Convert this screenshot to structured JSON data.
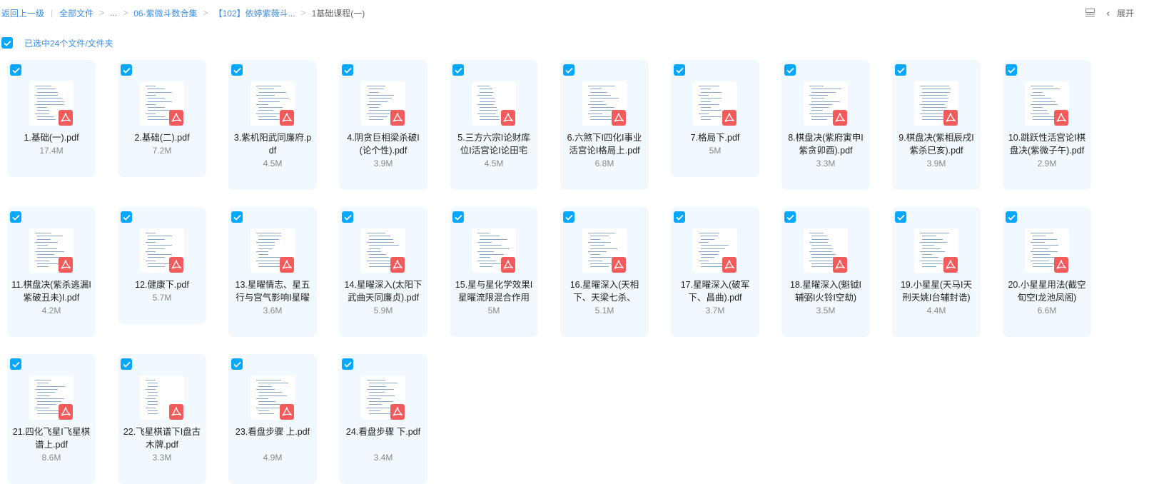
{
  "breadcrumb": {
    "back": "返回上一级",
    "items": [
      "全部文件",
      "...",
      "06-紫微斗数合集",
      "【102】依婷紫薇斗...",
      "1基础课程(一)"
    ]
  },
  "toolbar": {
    "expand": "展开"
  },
  "selection": {
    "text": "已选中24个文件/文件夹"
  },
  "colors": {
    "accent": "#06a7ff",
    "link": "#3b8ee6",
    "card_bg": "#f2f9fe",
    "pdf": "#f25b5b"
  },
  "files": [
    {
      "name": "1.基础(一).pdf",
      "size": "17.4M"
    },
    {
      "name": "2.基础(二).pdf",
      "size": "7.2M"
    },
    {
      "name": "3.紫机阳武同廉府.pdf",
      "size": "4.5M"
    },
    {
      "name": "4.阴贪巨相梁杀破I(论个性).pdf",
      "size": "3.9M"
    },
    {
      "name": "5.三方六宗I论财库位I活宫论I论田宅",
      "size": "4.5M"
    },
    {
      "name": "6.六煞下I四化I事业活宫论I格局上.pdf",
      "size": "6.8M"
    },
    {
      "name": "7.格局下.pdf",
      "size": "5M"
    },
    {
      "name": "8.棋盘决(紫府寅申I紫贪卯酉).pdf",
      "size": "3.3M"
    },
    {
      "name": "9.棋盘决(紫相辰戌I紫杀巳亥).pdf",
      "size": "3.9M"
    },
    {
      "name": "10.跳跃性活宫论I棋盘决(紫微子午).pdf",
      "size": "2.9M"
    },
    {
      "name": "11.棋盘决(紫杀逃漏I紫破丑未)I.pdf",
      "size": "4.2M"
    },
    {
      "name": "12.健康下.pdf",
      "size": "5.7M"
    },
    {
      "name": "13.星曜情志、星五行与宫气影响I星曜",
      "size": "3.6M"
    },
    {
      "name": "14.星曜深入(太阳下武曲天同廉贞).pdf",
      "size": "5.9M"
    },
    {
      "name": "15.星与星化学效果I星曜流限混合作用",
      "size": "5M"
    },
    {
      "name": "16.星曜深入(天相下、天梁七杀、",
      "size": "5.1M"
    },
    {
      "name": "17.星曜深入(破军下、昌曲).pdf",
      "size": "3.7M"
    },
    {
      "name": "18.星曜深入(魁钺I辅弼I火铃I空劫)",
      "size": "3.5M"
    },
    {
      "name": "19.小星星(天马I天刑天姚I台辅封诰)",
      "size": "4.4M"
    },
    {
      "name": "20.小星星用法(截空旬空I龙池凤阁)",
      "size": "6.6M"
    },
    {
      "name": "21.四化飞星I飞星棋谱上.pdf",
      "size": "8.6M"
    },
    {
      "name": "22.飞星棋谱下I盘古木牌.pdf",
      "size": "3.3M"
    },
    {
      "name": "23.看盘步骤 上.pdf",
      "size": "4.9M"
    },
    {
      "name": "24.看盘步骤 下.pdf",
      "size": "3.4M"
    }
  ]
}
